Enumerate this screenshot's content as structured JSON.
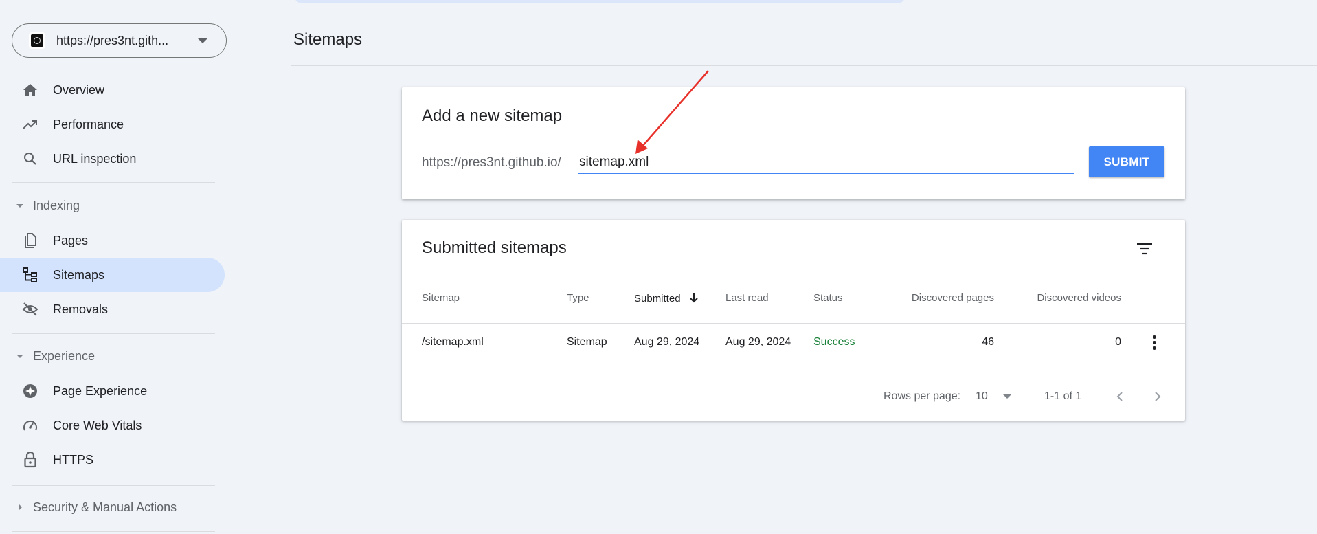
{
  "sidebar": {
    "property_url": "https://pres3nt.gith...",
    "items": {
      "overview": "Overview",
      "performance": "Performance",
      "url_inspection": "URL inspection",
      "pages": "Pages",
      "sitemaps": "Sitemaps",
      "removals": "Removals",
      "page_experience": "Page Experience",
      "core_web_vitals": "Core Web Vitals",
      "https": "HTTPS"
    },
    "sections": {
      "indexing": "Indexing",
      "experience": "Experience",
      "security": "Security & Manual Actions"
    }
  },
  "page": {
    "title": "Sitemaps"
  },
  "add_sitemap": {
    "title": "Add a new sitemap",
    "prefix": "https://pres3nt.github.io/",
    "input_value": "sitemap.xml",
    "submit_label": "SUBMIT"
  },
  "submitted": {
    "title": "Submitted sitemaps",
    "columns": {
      "sitemap": "Sitemap",
      "type": "Type",
      "submitted": "Submitted",
      "last_read": "Last read",
      "status": "Status",
      "discovered_pages": "Discovered pages",
      "discovered_videos": "Discovered videos"
    },
    "rows": [
      {
        "sitemap": "/sitemap.xml",
        "type": "Sitemap",
        "submitted": "Aug 29, 2024",
        "last_read": "Aug 29, 2024",
        "status": "Success",
        "discovered_pages": "46",
        "discovered_videos": "0"
      }
    ],
    "footer": {
      "rows_per_page_label": "Rows per page:",
      "rows_per_page_value": "10",
      "range": "1-1 of 1"
    }
  },
  "colors": {
    "accent": "#4285f4",
    "active_nav": "#d3e3fd",
    "success": "#188038",
    "annotation_arrow": "#e8302a"
  }
}
